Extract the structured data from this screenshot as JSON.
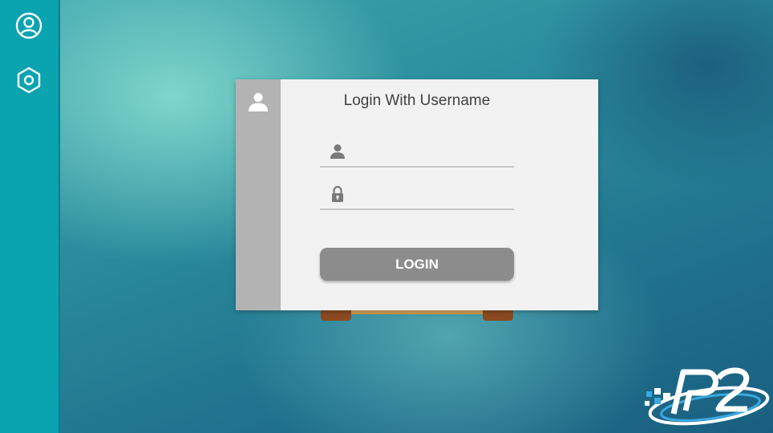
{
  "sidebar": {
    "items": [
      {
        "name": "profile",
        "icon": "user-circle-icon"
      },
      {
        "name": "settings",
        "icon": "hexagon-gear-icon"
      }
    ]
  },
  "dialog": {
    "title": "Login With Username",
    "strip_icon": "user-icon",
    "username": {
      "icon": "user-icon",
      "value": "",
      "placeholder": ""
    },
    "password": {
      "icon": "lock-icon",
      "value": "",
      "placeholder": ""
    },
    "login_label": "LOGIN"
  },
  "brand": {
    "logo": "p2-logo"
  },
  "colors": {
    "sidebar": "#0aa3b0",
    "dialog_bg": "#f2f2f2",
    "dialog_strip": "#b3b3b3",
    "button": "#8c8c8c",
    "button_text": "#ffffff"
  }
}
